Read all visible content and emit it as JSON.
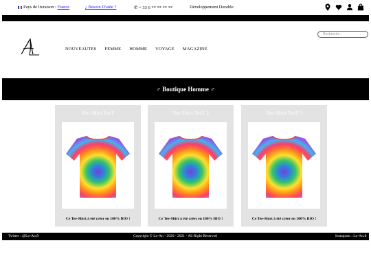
{
  "topbar": {
    "shipping_label": "Pays de livraison :",
    "shipping_country": "France",
    "help_link": "¿ Besoin D'aide ?",
    "phone": "✆ + 33 6 ** ** ** **",
    "sustainable": "Développement Durable",
    "icons": [
      "location-icon",
      "heart-icon",
      "user-icon",
      "bag-icon"
    ]
  },
  "header": {
    "nav": [
      "NOUVEAUTES",
      "FEMME",
      "HOMME",
      "VOYAGE",
      "MAGAZINE"
    ],
    "search_placeholder": "Recherche..."
  },
  "banner": {
    "title": "♂ Boutique Homme ♂"
  },
  "products": [
    {
      "name": "Tee-Shirt TeeT",
      "description": "Ce Tee-Shirt à été créer en 100% BIO !"
    },
    {
      "name": "Tee-Shirt TeeT 2",
      "description": "Ce Tee-Shirt à été créer en 100% BIO !"
    },
    {
      "name": "Tee-Shirt TeeT 3",
      "description": "Ce Tee-Shirt à été créer en 100% BIO !"
    }
  ],
  "footer": {
    "twitter": "Twitter : @Lo-An.fr",
    "copyright": "Copyright © Lo-An - 2020 - 2021 - All Right Reserved",
    "instagram": "Instagram : Lo-An.fr"
  },
  "colors": {
    "dark": "#000000",
    "card_bg": "#e3e3e3",
    "link": "#1a1aff"
  }
}
